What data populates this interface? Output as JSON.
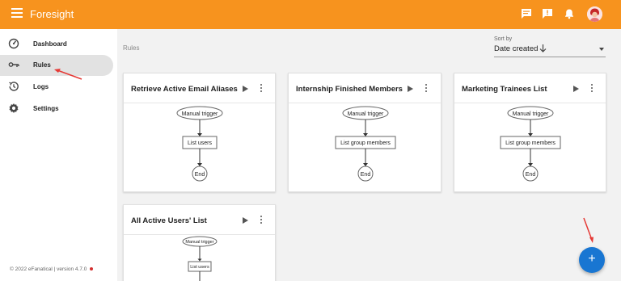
{
  "app": {
    "title": "Foresight"
  },
  "sidebar": {
    "items": [
      {
        "label": "Dashboard",
        "icon": "dashboard-icon"
      },
      {
        "label": "Rules",
        "icon": "rules-icon",
        "active": true
      },
      {
        "label": "Logs",
        "icon": "history-icon"
      },
      {
        "label": "Settings",
        "icon": "gear-icon"
      }
    ],
    "footer": "© 2022 eFanatical | version 4.7.0"
  },
  "main": {
    "breadcrumb": "Rules",
    "sort": {
      "label": "Sort by",
      "value": "Date created"
    }
  },
  "rules": [
    {
      "title": "Retrieve Active Email Aliases",
      "trigger": "Manual trigger",
      "action": "List users",
      "end": "End"
    },
    {
      "title": "Internship Finished Members",
      "trigger": "Manual trigger",
      "action": "List group members",
      "end": "End"
    },
    {
      "title": "Marketing Trainees List",
      "trigger": "Manual trigger",
      "action": "List group members",
      "end": "End"
    },
    {
      "title": "All Active Users' List",
      "trigger": "Manual trigger",
      "action": "List users",
      "end": ""
    }
  ],
  "fab": {
    "label": "+"
  },
  "colors": {
    "topbar": "#f7931e",
    "fab": "#1976d2",
    "annotation": "#e53935"
  }
}
